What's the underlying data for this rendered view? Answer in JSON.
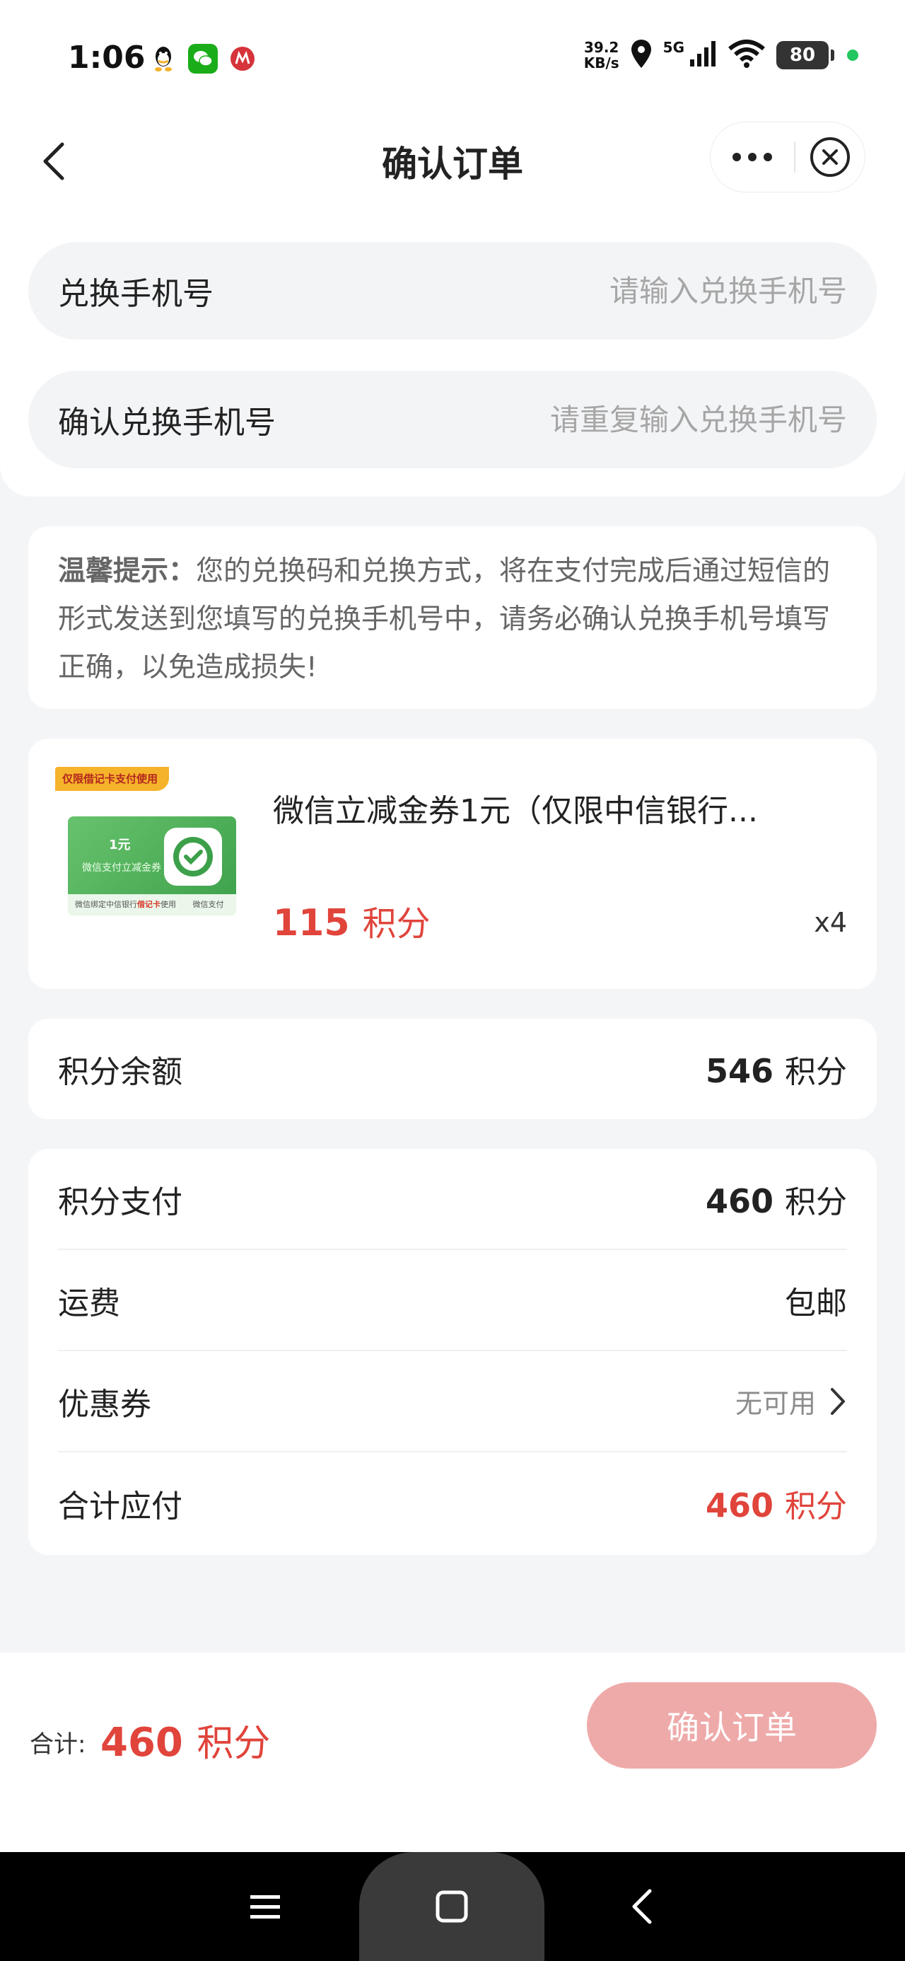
{
  "status_bar": {
    "time": "1:06",
    "net_speed_value": "39.2",
    "net_speed_unit": "KB/s",
    "network": "5G",
    "battery": "80"
  },
  "nav": {
    "title": "确认订单"
  },
  "form": {
    "phone_label": "兑换手机号",
    "phone_placeholder": "请输入兑换手机号",
    "confirm_phone_label": "确认兑换手机号",
    "confirm_phone_placeholder": "请重复输入兑换手机号"
  },
  "tip": {
    "prefix": "温馨提示：",
    "text": "您的兑换码和兑换方式，将在支付完成后通过短信的形式发送到您填写的兑换手机号中，请务必确认兑换手机号填写正确，以免造成损失!"
  },
  "product": {
    "badge": "仅限借记卡支付使用",
    "image_amount": "1元",
    "image_name": "微信支付立减金券",
    "image_footer_prefix": "微信绑定中信银行",
    "image_footer_highlight": "借记卡",
    "image_footer_suffix": "使用",
    "image_footer_pay": "微信支付",
    "title": "微信立减金券1元（仅限中信银行...",
    "price_value": "115",
    "price_unit": "积分",
    "quantity": "x4"
  },
  "balance": {
    "label": "积分余额",
    "value": "546",
    "unit": "积分"
  },
  "summary": {
    "points_pay_label": "积分支付",
    "points_pay_value": "460",
    "points_pay_unit": "积分",
    "shipping_label": "运费",
    "shipping_value": "包邮",
    "coupon_label": "优惠券",
    "coupon_value": "无可用",
    "total_label": "合计应付",
    "total_value": "460",
    "total_unit": "积分"
  },
  "footer": {
    "total_label": "合计:",
    "total_value": "460",
    "total_unit": "积分",
    "confirm_button": "确认订单"
  },
  "colors": {
    "accent_red": "#e0443b",
    "button_disabled": "#eeaaa9",
    "wechat_green": "#1aad19"
  }
}
